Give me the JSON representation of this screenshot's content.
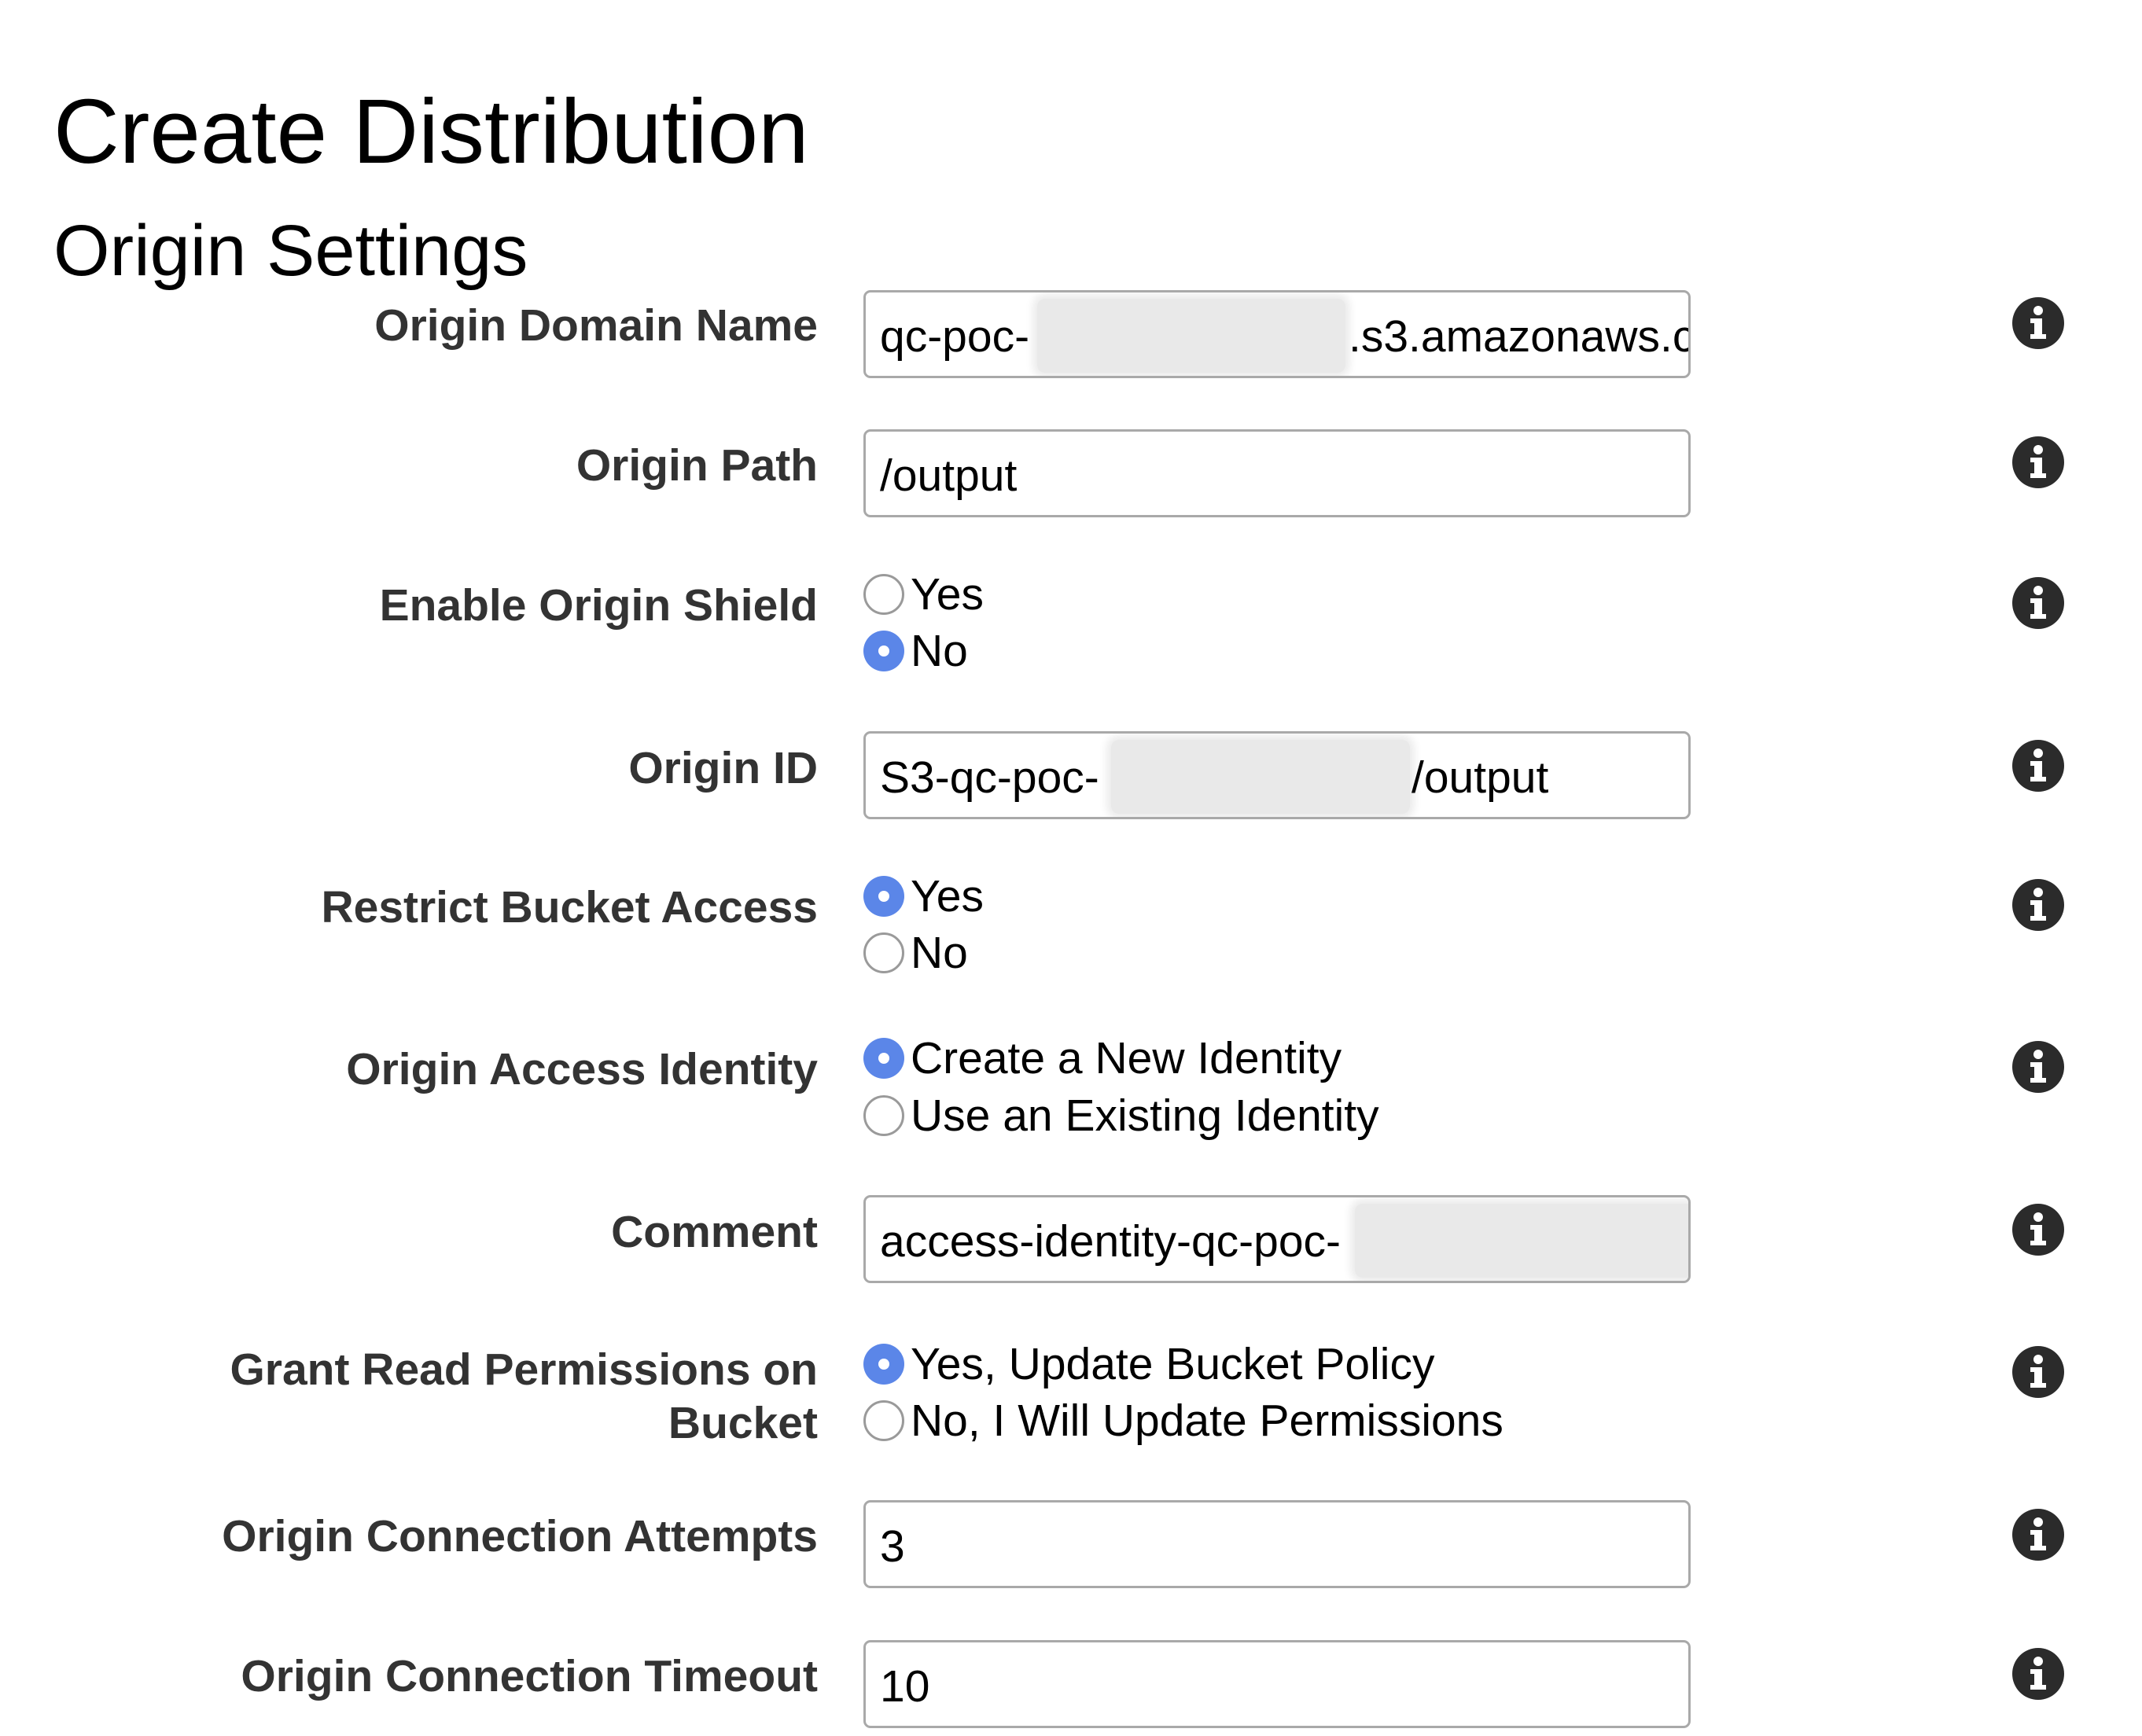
{
  "page": {
    "title": "Create Distribution",
    "section_title": "Origin Settings"
  },
  "form": {
    "origin_domain_name": {
      "label": "Origin Domain Name",
      "value_prefix": "qc-poc-",
      "value_suffix": ".s3.amazonaws.c"
    },
    "origin_path": {
      "label": "Origin Path",
      "value": "/output"
    },
    "enable_origin_shield": {
      "label": "Enable Origin Shield",
      "options": [
        "Yes",
        "No"
      ],
      "selected": "No"
    },
    "origin_id": {
      "label": "Origin ID",
      "value_prefix": "S3-qc-poc-",
      "value_suffix": "/output"
    },
    "restrict_bucket_access": {
      "label": "Restrict Bucket Access",
      "options": [
        "Yes",
        "No"
      ],
      "selected": "Yes"
    },
    "origin_access_identity": {
      "label": "Origin Access Identity",
      "options": [
        "Create a New Identity",
        "Use an Existing Identity"
      ],
      "selected": "Create a New Identity"
    },
    "comment": {
      "label": "Comment",
      "value_prefix": "access-identity-qc-poc-"
    },
    "grant_read_permissions": {
      "label": "Grant Read Permissions on Bucket",
      "options": [
        "Yes, Update Bucket Policy",
        "No, I Will Update Permissions"
      ],
      "selected": "Yes, Update Bucket Policy"
    },
    "origin_connection_attempts": {
      "label": "Origin Connection Attempts",
      "value": "3"
    },
    "origin_connection_timeout": {
      "label": "Origin Connection Timeout",
      "value": "10"
    }
  },
  "icons": {
    "info": "info-icon"
  },
  "colors": {
    "radio_selected": "#5b86e8",
    "label_text": "#333333",
    "input_border": "#a9a9a9"
  }
}
